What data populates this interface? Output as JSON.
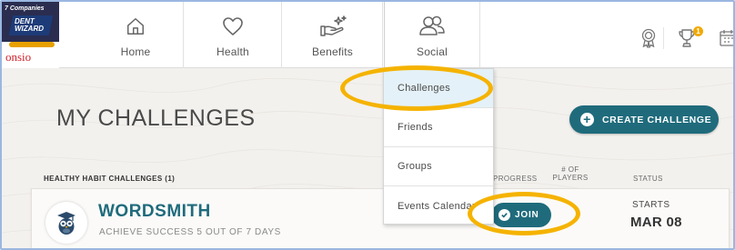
{
  "logo": {
    "top_text": "7 Companies",
    "band_text": "DENT WIZARD",
    "bottom_text": "onsio"
  },
  "nav": {
    "items": [
      {
        "label": "Home",
        "icon": "home-icon"
      },
      {
        "label": "Health",
        "icon": "heart-icon"
      },
      {
        "label": "Benefits",
        "icon": "hand-sparkle-icon"
      },
      {
        "label": "Social",
        "icon": "people-icon"
      }
    ],
    "right_icons": [
      "award-icon",
      "trophy-icon",
      "calendar-icon"
    ],
    "trophy_badge": "1"
  },
  "social_menu": {
    "items": [
      "Challenges",
      "Friends",
      "Groups",
      "Events Calendar"
    ]
  },
  "page": {
    "title": "MY CHALLENGES",
    "create_button": "CREATE CHALLENGE",
    "section_label": "HEALTHY HABIT CHALLENGES (1)",
    "columns": {
      "progress": "PROGRESS",
      "players": "# OF PLAYERS",
      "status": "STATUS"
    }
  },
  "challenge": {
    "name": "WORDSMITH",
    "description": "ACHIEVE SUCCESS 5 OUT OF 7 DAYS",
    "join_label": "JOIN",
    "status_label": "STARTS",
    "status_date": "MAR 08"
  },
  "colors": {
    "accent": "#1f6b7c",
    "highlight": "#f5b300",
    "menu_selected": "#e4f1f8"
  }
}
